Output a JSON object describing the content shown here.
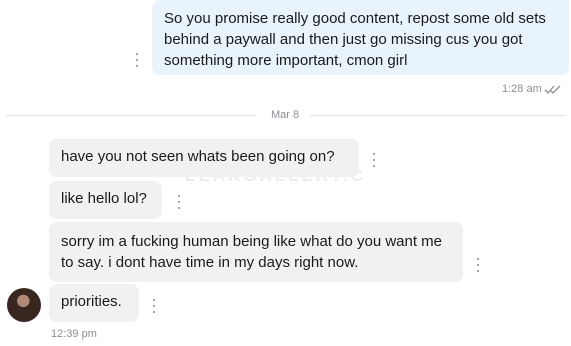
{
  "messages_sent": [
    {
      "text": "So you promise really good content, repost some old sets behind a paywall and then just go missing cus you got something more important, cmon girl"
    }
  ],
  "sent_meta": {
    "time": "1:28 am",
    "read_icon": "double-check-icon"
  },
  "date_divider": {
    "label": "Mar 8"
  },
  "messages_received": [
    {
      "text": "have you not seen whats been going on?"
    },
    {
      "text": "like hello lol?"
    },
    {
      "text": "sorry im a fucking human being like what do you want me to say. i dont have time in my days right now."
    },
    {
      "text": "priorities."
    }
  ],
  "received_meta": {
    "time": "12:39 pm"
  },
  "watermark": {
    "text": "LEAKGALLERY.C"
  },
  "colors": {
    "sent_bubble": "#e9f3fc",
    "received_bubble": "#f1f1f4",
    "meta_text": "#8a8f98"
  }
}
